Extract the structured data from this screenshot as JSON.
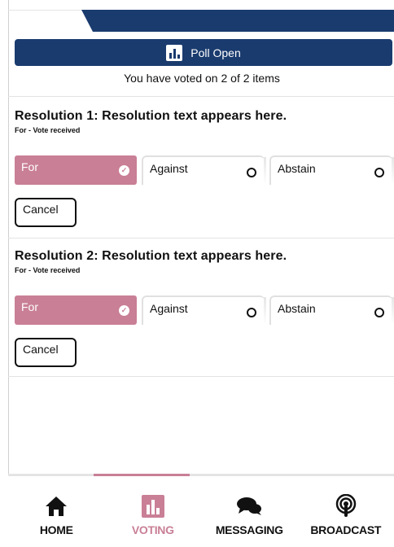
{
  "poll": {
    "banner_label": "Poll Open",
    "voted_summary": "You have voted on 2 of 2 items"
  },
  "resolutions": [
    {
      "title": "Resolution 1: Resolution text appears here.",
      "status": "For - Vote received",
      "options": {
        "for": "For",
        "against": "Against",
        "abstain": "Abstain"
      },
      "selected": "For",
      "cancel_label": "Cancel"
    },
    {
      "title": "Resolution 2: Resolution text appears here.",
      "status": "For - Vote received",
      "options": {
        "for": "For",
        "against": "Against",
        "abstain": "Abstain"
      },
      "selected": "For",
      "cancel_label": "Cancel"
    }
  ],
  "nav": {
    "home": "HOME",
    "voting": "VOTING",
    "messaging": "MESSAGING",
    "broadcast": "BROADCAST",
    "active": "VOTING"
  },
  "colors": {
    "navy": "#1a3b6e",
    "accent": "#c97f96"
  }
}
